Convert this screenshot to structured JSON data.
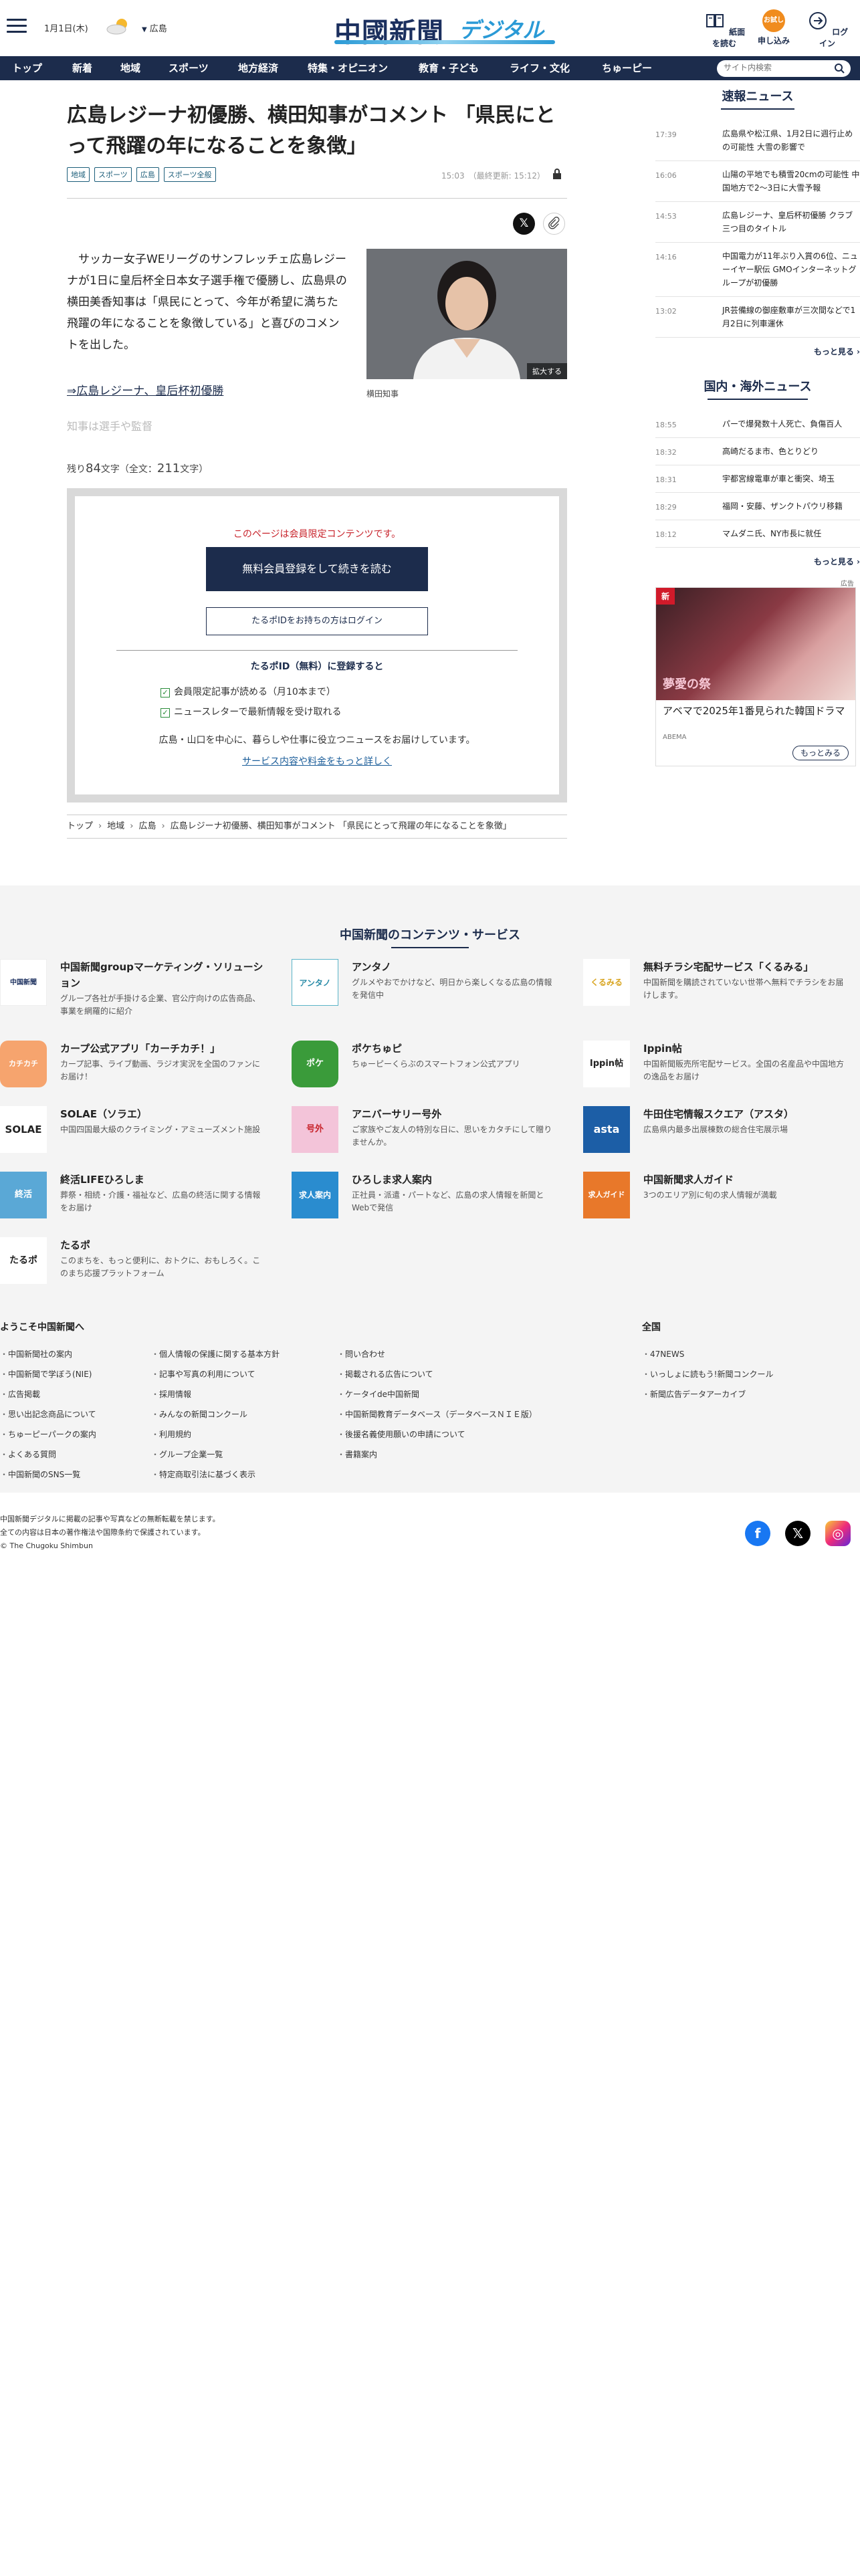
{
  "header": {
    "date": "1月1日(木)",
    "area": "広島",
    "logo_kanji": "中國新聞",
    "logo_sub": "デジタル",
    "tools": [
      {
        "label": "紙面を読む",
        "icon": "newspaper-icon"
      },
      {
        "label": "申し込み",
        "icon": "apply-icon",
        "badge": "お試し 無料"
      },
      {
        "label": "ログイン",
        "icon": "login-icon"
      }
    ]
  },
  "nav": {
    "items": [
      "トップ",
      "新着",
      "地域",
      "スポーツ",
      "地方経済",
      "特集・オピニオン",
      "教育・子ども",
      "ライフ・文化",
      "ちゅーピー"
    ],
    "search_placeholder": "サイト内検索"
  },
  "article": {
    "title": "広島レジーナ初優勝、横田知事がコメント 「県民にとって飛躍の年になることを象徴」",
    "tags": [
      "地域",
      "スポーツ",
      "広島",
      "スポーツ全般"
    ],
    "published": "15:03",
    "updated": "（最終更新: 15:12）",
    "lead": "サッカー女子WEリーグのサンフレッチェ広島レジーナが1日に皇后杯全日本女子選手権で優勝し、広島県の横田美香知事は「県民にとって、今年が希望に満ちた飛躍の年になることを象徴している」と喜びのコメントを出した。",
    "photo_zoom": "拡大する",
    "photo_caption": "横田知事",
    "related_link": "⇒広島レジーナ、皇后杯初優勝",
    "faded_text": "知事は選手や監督",
    "remaining_prefix": "残り",
    "remaining_count": "84",
    "remaining_mid": "文字（全文：",
    "total_count": "211",
    "remaining_suffix": "文字）"
  },
  "paywall": {
    "message": "このページは会員限定コンテンツです。",
    "register_button": "無料会員登録をして続きを読む",
    "login_button": "たるポIDをお持ちの方はログイン",
    "register_title": "たるポID（無料）に登録すると",
    "benefits": [
      "会員限定記事が読める（月10本まで）",
      "ニュースレターで最新情報を受け取れる"
    ],
    "description": "広島・山口を中心に、暮らしや仕事に役立つニュースをお届けしています。",
    "more_link": "サービス内容や料金をもっと詳しく"
  },
  "breadcrumb": [
    "トップ",
    "地域",
    "広島",
    "広島レジーナ初優勝、横田知事がコメント 「県民にとって飛躍の年になることを象徴」"
  ],
  "sidebar": {
    "flash_title": "速報ニュース",
    "flash": [
      {
        "time": "17:39",
        "text": "広島県や松江県、1月2日に週行止めの可能性 大雪の影響で"
      },
      {
        "time": "16:06",
        "text": "山陽の平地でも積雪20cmの可能性 中国地方で2～3日に大雪予報"
      },
      {
        "time": "14:53",
        "text": "広島レジーナ、皇后杯初優勝 クラブ三つ目のタイトル"
      },
      {
        "time": "14:16",
        "text": "中国電力が11年ぶり入賞の6位、ニューイヤー駅伝 GMOインターネットグループが初優勝"
      },
      {
        "time": "13:02",
        "text": "JR芸備線の御座敷車が三次間などで1月2日に列車運休"
      }
    ],
    "more": "もっと見る",
    "world_title": "国内・海外ニュース",
    "world": [
      {
        "time": "18:55",
        "text": "パーで爆発数十人死亡、負傷百人"
      },
      {
        "time": "18:32",
        "text": "高崎だるま市、色とりどり"
      },
      {
        "time": "18:31",
        "text": "宇都宮線電車が車と衝突、埼玉"
      },
      {
        "time": "18:29",
        "text": "福岡・安藤、ザンクトパウリ移籍"
      },
      {
        "time": "18:12",
        "text": "マムダニ氏、NY市長に就任"
      }
    ],
    "ad": {
      "badge": "新",
      "tag": "広告",
      "show_logo": "夢愛の祭",
      "title": "アベマで2025年1番見られた韓国ドラマ",
      "source": "ABEMA",
      "button": "もっとみる"
    }
  },
  "services": {
    "title": "中国新聞のコンテンツ・サービス",
    "items": [
      {
        "name": "中国新聞groupマーケティング・ソリューション",
        "desc": "グループ各社が手掛ける企業、官公庁向けの広告商品、事業を網羅的に紹介",
        "logo": "中国新聞",
        "color": "#ffffff"
      },
      {
        "name": "アンタノ",
        "desc": "グルメやおでかけなど、明日から楽しくなる広島の情報を発信中",
        "logo": "アンタノ",
        "color": "#ffffff"
      },
      {
        "name": "無料チラシ宅配サービス「くるみる」",
        "desc": "中国新聞を購読されていない世帯へ無料でチラシをお届けします。",
        "logo": "くるみる",
        "color": "#ffffff"
      },
      {
        "name": "カープ公式アプリ「カーチカチ！」",
        "desc": "カープ記事、ライブ動画、ラジオ実況を全国のファンにお届け！",
        "logo": "カチカチ",
        "color": "#f6a46e"
      },
      {
        "name": "ポケちゅピ",
        "desc": "ちゅーピーくらぶのスマートフォン公式アプリ",
        "logo": "ポケ",
        "color": "#3a9b3a"
      },
      {
        "name": "Ippin帖",
        "desc": "中国新聞販売所宅配サービス。全国の名産品や中国地方の逸品をお届け",
        "logo": "Ippin帖",
        "color": "#ffffff"
      },
      {
        "name": "SOLAE（ソラエ）",
        "desc": "中国四国最大級のクライミング・アミューズメント施設",
        "logo": "SOLAE",
        "color": "#ffffff"
      },
      {
        "name": "アニバーサリー号外",
        "desc": "ご家族やご友人の特別な日に、思いをカタチにして贈りませんか。",
        "logo": "号外",
        "color": "#f3c4d9"
      },
      {
        "name": "牛田住宅情報スクエア（アスタ）",
        "desc": "広島県内最多出展棟数の総合住宅展示場",
        "logo": "asta",
        "color": "#1c5ea6"
      },
      {
        "name": "終活LIFEひろしま",
        "desc": "葬祭・相続・介護・福祉など、広島の終活に関する情報をお届け",
        "logo": "終活",
        "color": "#5aa8d6"
      },
      {
        "name": "ひろしま求人案内",
        "desc": "正社員・派遣・パートなど、広島の求人情報を新聞とWebで発信",
        "logo": "求人案内",
        "color": "#2a8ccf"
      },
      {
        "name": "中国新聞求人ガイド",
        "desc": "3つのエリア別に旬の求人情報が満載",
        "logo": "求人ガイド",
        "color": "#e8782a"
      },
      {
        "name": "たるポ",
        "desc": "このまちを、もっと便利に、おトクに、おもしろく。このまち応援プラットフォーム",
        "logo": "たるポ",
        "color": "#ffffff"
      }
    ]
  },
  "footer": {
    "welcome_title": "ようこそ中国新聞へ",
    "col1": [
      "中国新聞社の案内",
      "中国新聞で学ぼう(NIE)",
      "広告掲載",
      "思い出記念商品について",
      "ちゅーピーパークの案内",
      "よくある質問",
      "中国新聞のSNS一覧"
    ],
    "col2": [
      "個人情報の保護に関する基本方針",
      "記事や写真の利用について",
      "採用情報",
      "みんなの新聞コンクール",
      "利用規約",
      "グループ企業一覧",
      "特定商取引法に基づく表示"
    ],
    "col3": [
      "問い合わせ",
      "掲載される広告について",
      "ケータイde中国新聞",
      "中国新聞教育データベース（データベースＮＩＥ版）",
      "後援名義使用願いの申請について",
      "書籍案内"
    ],
    "national_title": "全国",
    "national": [
      "47NEWS",
      "いっしょに読もう!新聞コンクール",
      "新聞広告データアーカイブ"
    ],
    "copy": [
      "中国新聞デジタルに掲載の記事や写真などの無断転載を禁じます。",
      "全ての内容は日本の著作権法や国際条約で保護されています。",
      "© The Chugoku Shimbun"
    ],
    "sns": [
      "facebook-icon",
      "x-icon",
      "instagram-icon"
    ]
  },
  "colors": {
    "navy": "#1c2c4c",
    "accent_red": "#c8242c",
    "orange": "#f08c1e"
  }
}
